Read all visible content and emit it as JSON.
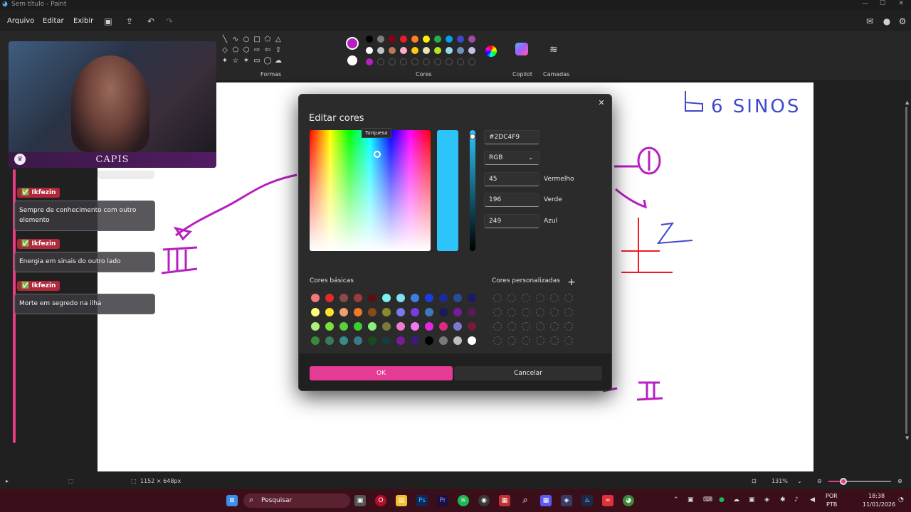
{
  "window": {
    "title": "Sem título - Paint",
    "controls": [
      "—",
      "☐",
      "✕"
    ]
  },
  "menu": {
    "file": "Arquivo",
    "edit": "Editar",
    "view": "Exibir"
  },
  "ribbon": {
    "shapes_label": "Formas",
    "colors_label": "Cores",
    "copilot_label": "Copilot",
    "layers_label": "Camadas",
    "primary_color": "#b620c0",
    "secondary_color": "#ffffff",
    "palette_row1": [
      "#000000",
      "#7f7f7f",
      "#880015",
      "#ed1c24",
      "#ff7f27",
      "#fff200",
      "#22b14c",
      "#00a2e8",
      "#3f48cc",
      "#a349a4"
    ],
    "palette_row2": [
      "#ffffff",
      "#c3c3c3",
      "#b97a57",
      "#ffaec9",
      "#ffc90e",
      "#efe4b0",
      "#b5e61d",
      "#99d9ea",
      "#7092be",
      "#c8bfe7"
    ],
    "palette_row3": [
      "#b620c0"
    ]
  },
  "stream": {
    "overlay_name": "CAPIS",
    "chat": [
      {
        "user": "Ikfezin",
        "message": "Sempre de conhecimento com outro elemento"
      },
      {
        "user": "Ikfezin",
        "message": "Energia em sinais do outro lado"
      },
      {
        "user": "Ikfezin",
        "message": "Morte em segredo na ilha"
      }
    ]
  },
  "canvas": {
    "heading": "6 SINOS"
  },
  "dialog": {
    "title": "Editar cores",
    "tooltip": "Turquesa",
    "hex": "#2DC4F9",
    "mode": "RGB",
    "red_value": "45",
    "red_label": "Vermelho",
    "green_value": "196",
    "green_label": "Verde",
    "blue_value": "249",
    "blue_label": "Azul",
    "basic_colors_label": "Cores básicas",
    "custom_colors_label": "Cores personalizadas",
    "ok_label": "OK",
    "cancel_label": "Cancelar",
    "basic_colors": [
      [
        "#f07a7a",
        "#e22a2a",
        "#8a4a4a",
        "#9c3b3b",
        "#5a1010",
        "#7ff0f0",
        "#7fe0f0",
        "#3b7fe0",
        "#1a3be0",
        "#1a2a9c",
        "#2a4a9c",
        "#1a1a6b"
      ],
      [
        "#fffa7a",
        "#ffe02a",
        "#f0a070",
        "#f07a2a",
        "#8a4a1a",
        "#8a8a2a",
        "#7a7af0",
        "#7a3be0",
        "#3b7abf",
        "#1a1a5a",
        "#7a1a9c",
        "#5a1a5a"
      ],
      [
        "#b0f07a",
        "#7ae03b",
        "#5ad03b",
        "#3bd02a",
        "#8af07a",
        "#7a7a3b",
        "#f07ad0",
        "#f07af0",
        "#e02ae0",
        "#e02a7a",
        "#7a7ad0",
        "#7a1a3b"
      ],
      [
        "#3b8a3b",
        "#3b7a5a",
        "#3b8a8a",
        "#3b7a8a",
        "#1a4a1a",
        "#1a3b3b",
        "#7a1a9c",
        "#3b1a7a",
        "#000000",
        "#7a7a7a",
        "#bfbfbf",
        "#ffffff"
      ]
    ]
  },
  "status": {
    "canvas_size": "1152 × 648px",
    "zoom": "131%"
  },
  "taskbar": {
    "search_placeholder": "Pesquisar",
    "lang_top": "POR",
    "lang_bottom": "PTB",
    "time": "18:38",
    "date": "11/01/2026"
  }
}
